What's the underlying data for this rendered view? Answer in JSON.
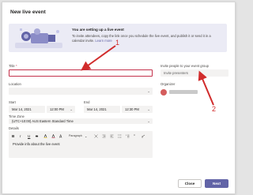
{
  "dialog": {
    "title": "New live event"
  },
  "banner": {
    "title": "You are setting up a live event",
    "body": "To invite attendees, copy the link once you schedule the live event, and publish it or send it in a calendar invite.",
    "link": "Learn more"
  },
  "form": {
    "title_label": "Title",
    "title_required": "*",
    "title_value": "",
    "location_label": "Location",
    "location_value": "",
    "start_label": "Start",
    "start_date": "Mar 14, 2021",
    "start_time": "12:00 PM",
    "end_label": "End",
    "end_date": "Mar 14, 2021",
    "end_time": "12:30 PM",
    "timezone_label": "Time Zone",
    "timezone_value": "(UTC+10:00) AUS Eastern Standard Time",
    "details_label": "Details",
    "details_placeholder": "Provide info about the live event"
  },
  "toolbar": {
    "bold": "B",
    "italic": "I",
    "underline": "U",
    "strike": "S",
    "paragraph": "Paragraph"
  },
  "side": {
    "invite_label": "Invite people to your event group",
    "invite_placeholder": "Invite presenters",
    "organizer_label": "Organizer"
  },
  "buttons": {
    "close": "Close",
    "next": "Next"
  },
  "annotations": {
    "one": "1",
    "two": "2"
  },
  "colors": {
    "accent": "#6264a7",
    "error": "#c4314b",
    "annotation": "#d12c2c"
  }
}
